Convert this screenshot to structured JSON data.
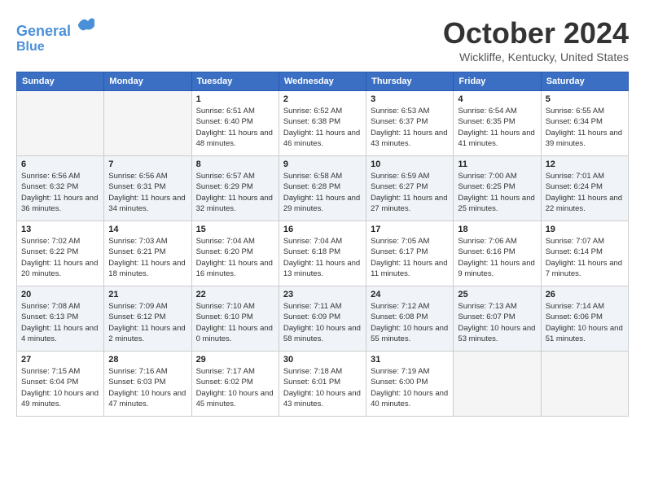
{
  "logo": {
    "line1": "General",
    "line2": "Blue"
  },
  "title": "October 2024",
  "location": "Wickliffe, Kentucky, United States",
  "headers": [
    "Sunday",
    "Monday",
    "Tuesday",
    "Wednesday",
    "Thursday",
    "Friday",
    "Saturday"
  ],
  "weeks": [
    [
      {
        "day": "",
        "sunrise": "",
        "sunset": "",
        "daylight": ""
      },
      {
        "day": "",
        "sunrise": "",
        "sunset": "",
        "daylight": ""
      },
      {
        "day": "1",
        "sunrise": "Sunrise: 6:51 AM",
        "sunset": "Sunset: 6:40 PM",
        "daylight": "Daylight: 11 hours and 48 minutes."
      },
      {
        "day": "2",
        "sunrise": "Sunrise: 6:52 AM",
        "sunset": "Sunset: 6:38 PM",
        "daylight": "Daylight: 11 hours and 46 minutes."
      },
      {
        "day": "3",
        "sunrise": "Sunrise: 6:53 AM",
        "sunset": "Sunset: 6:37 PM",
        "daylight": "Daylight: 11 hours and 43 minutes."
      },
      {
        "day": "4",
        "sunrise": "Sunrise: 6:54 AM",
        "sunset": "Sunset: 6:35 PM",
        "daylight": "Daylight: 11 hours and 41 minutes."
      },
      {
        "day": "5",
        "sunrise": "Sunrise: 6:55 AM",
        "sunset": "Sunset: 6:34 PM",
        "daylight": "Daylight: 11 hours and 39 minutes."
      }
    ],
    [
      {
        "day": "6",
        "sunrise": "Sunrise: 6:56 AM",
        "sunset": "Sunset: 6:32 PM",
        "daylight": "Daylight: 11 hours and 36 minutes."
      },
      {
        "day": "7",
        "sunrise": "Sunrise: 6:56 AM",
        "sunset": "Sunset: 6:31 PM",
        "daylight": "Daylight: 11 hours and 34 minutes."
      },
      {
        "day": "8",
        "sunrise": "Sunrise: 6:57 AM",
        "sunset": "Sunset: 6:29 PM",
        "daylight": "Daylight: 11 hours and 32 minutes."
      },
      {
        "day": "9",
        "sunrise": "Sunrise: 6:58 AM",
        "sunset": "Sunset: 6:28 PM",
        "daylight": "Daylight: 11 hours and 29 minutes."
      },
      {
        "day": "10",
        "sunrise": "Sunrise: 6:59 AM",
        "sunset": "Sunset: 6:27 PM",
        "daylight": "Daylight: 11 hours and 27 minutes."
      },
      {
        "day": "11",
        "sunrise": "Sunrise: 7:00 AM",
        "sunset": "Sunset: 6:25 PM",
        "daylight": "Daylight: 11 hours and 25 minutes."
      },
      {
        "day": "12",
        "sunrise": "Sunrise: 7:01 AM",
        "sunset": "Sunset: 6:24 PM",
        "daylight": "Daylight: 11 hours and 22 minutes."
      }
    ],
    [
      {
        "day": "13",
        "sunrise": "Sunrise: 7:02 AM",
        "sunset": "Sunset: 6:22 PM",
        "daylight": "Daylight: 11 hours and 20 minutes."
      },
      {
        "day": "14",
        "sunrise": "Sunrise: 7:03 AM",
        "sunset": "Sunset: 6:21 PM",
        "daylight": "Daylight: 11 hours and 18 minutes."
      },
      {
        "day": "15",
        "sunrise": "Sunrise: 7:04 AM",
        "sunset": "Sunset: 6:20 PM",
        "daylight": "Daylight: 11 hours and 16 minutes."
      },
      {
        "day": "16",
        "sunrise": "Sunrise: 7:04 AM",
        "sunset": "Sunset: 6:18 PM",
        "daylight": "Daylight: 11 hours and 13 minutes."
      },
      {
        "day": "17",
        "sunrise": "Sunrise: 7:05 AM",
        "sunset": "Sunset: 6:17 PM",
        "daylight": "Daylight: 11 hours and 11 minutes."
      },
      {
        "day": "18",
        "sunrise": "Sunrise: 7:06 AM",
        "sunset": "Sunset: 6:16 PM",
        "daylight": "Daylight: 11 hours and 9 minutes."
      },
      {
        "day": "19",
        "sunrise": "Sunrise: 7:07 AM",
        "sunset": "Sunset: 6:14 PM",
        "daylight": "Daylight: 11 hours and 7 minutes."
      }
    ],
    [
      {
        "day": "20",
        "sunrise": "Sunrise: 7:08 AM",
        "sunset": "Sunset: 6:13 PM",
        "daylight": "Daylight: 11 hours and 4 minutes."
      },
      {
        "day": "21",
        "sunrise": "Sunrise: 7:09 AM",
        "sunset": "Sunset: 6:12 PM",
        "daylight": "Daylight: 11 hours and 2 minutes."
      },
      {
        "day": "22",
        "sunrise": "Sunrise: 7:10 AM",
        "sunset": "Sunset: 6:10 PM",
        "daylight": "Daylight: 11 hours and 0 minutes."
      },
      {
        "day": "23",
        "sunrise": "Sunrise: 7:11 AM",
        "sunset": "Sunset: 6:09 PM",
        "daylight": "Daylight: 10 hours and 58 minutes."
      },
      {
        "day": "24",
        "sunrise": "Sunrise: 7:12 AM",
        "sunset": "Sunset: 6:08 PM",
        "daylight": "Daylight: 10 hours and 55 minutes."
      },
      {
        "day": "25",
        "sunrise": "Sunrise: 7:13 AM",
        "sunset": "Sunset: 6:07 PM",
        "daylight": "Daylight: 10 hours and 53 minutes."
      },
      {
        "day": "26",
        "sunrise": "Sunrise: 7:14 AM",
        "sunset": "Sunset: 6:06 PM",
        "daylight": "Daylight: 10 hours and 51 minutes."
      }
    ],
    [
      {
        "day": "27",
        "sunrise": "Sunrise: 7:15 AM",
        "sunset": "Sunset: 6:04 PM",
        "daylight": "Daylight: 10 hours and 49 minutes."
      },
      {
        "day": "28",
        "sunrise": "Sunrise: 7:16 AM",
        "sunset": "Sunset: 6:03 PM",
        "daylight": "Daylight: 10 hours and 47 minutes."
      },
      {
        "day": "29",
        "sunrise": "Sunrise: 7:17 AM",
        "sunset": "Sunset: 6:02 PM",
        "daylight": "Daylight: 10 hours and 45 minutes."
      },
      {
        "day": "30",
        "sunrise": "Sunrise: 7:18 AM",
        "sunset": "Sunset: 6:01 PM",
        "daylight": "Daylight: 10 hours and 43 minutes."
      },
      {
        "day": "31",
        "sunrise": "Sunrise: 7:19 AM",
        "sunset": "Sunset: 6:00 PM",
        "daylight": "Daylight: 10 hours and 40 minutes."
      },
      {
        "day": "",
        "sunrise": "",
        "sunset": "",
        "daylight": ""
      },
      {
        "day": "",
        "sunrise": "",
        "sunset": "",
        "daylight": ""
      }
    ]
  ]
}
